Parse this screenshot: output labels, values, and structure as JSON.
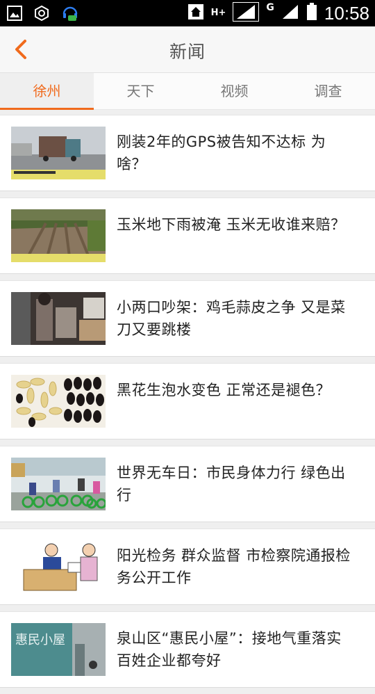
{
  "status": {
    "time": "10:58",
    "network": "H+",
    "carrier_g": "G"
  },
  "header": {
    "title": "新闻"
  },
  "tabs": [
    {
      "label": "徐州",
      "active": true
    },
    {
      "label": "天下",
      "active": false
    },
    {
      "label": "视频",
      "active": false
    },
    {
      "label": "调查",
      "active": false
    }
  ],
  "news": [
    {
      "title": "刚装2年的GPS被告知不达标 为啥？",
      "thumb": "truck-highway-thumbnail"
    },
    {
      "title": "玉米地下雨被淹 玉米无收谁来赔？",
      "thumb": "cornfield-thumbnail"
    },
    {
      "title": "小两口吵架：鸡毛蒜皮之争 又是菜刀又要跳楼",
      "thumb": "couple-argument-thumbnail"
    },
    {
      "title": "黑花生泡水变色  正常还是褪色？",
      "thumb": "black-peanuts-thumbnail"
    },
    {
      "title": "世界无车日：市民身体力行 绿色出行",
      "thumb": "cyclists-thumbnail"
    },
    {
      "title": "阳光检务 群众监督 市检察院通报检务公开工作",
      "thumb": "officials-cartoon-thumbnail"
    },
    {
      "title": "泉山区“惠民小屋”：接地气重落实 百姓企业都夸好",
      "thumb": "huimin-house-thumbnail",
      "thumb_text": "惠民小屋"
    }
  ],
  "colors": {
    "accent": "#f06a1c",
    "title_text": "#222222",
    "status_bar": "#000000"
  }
}
